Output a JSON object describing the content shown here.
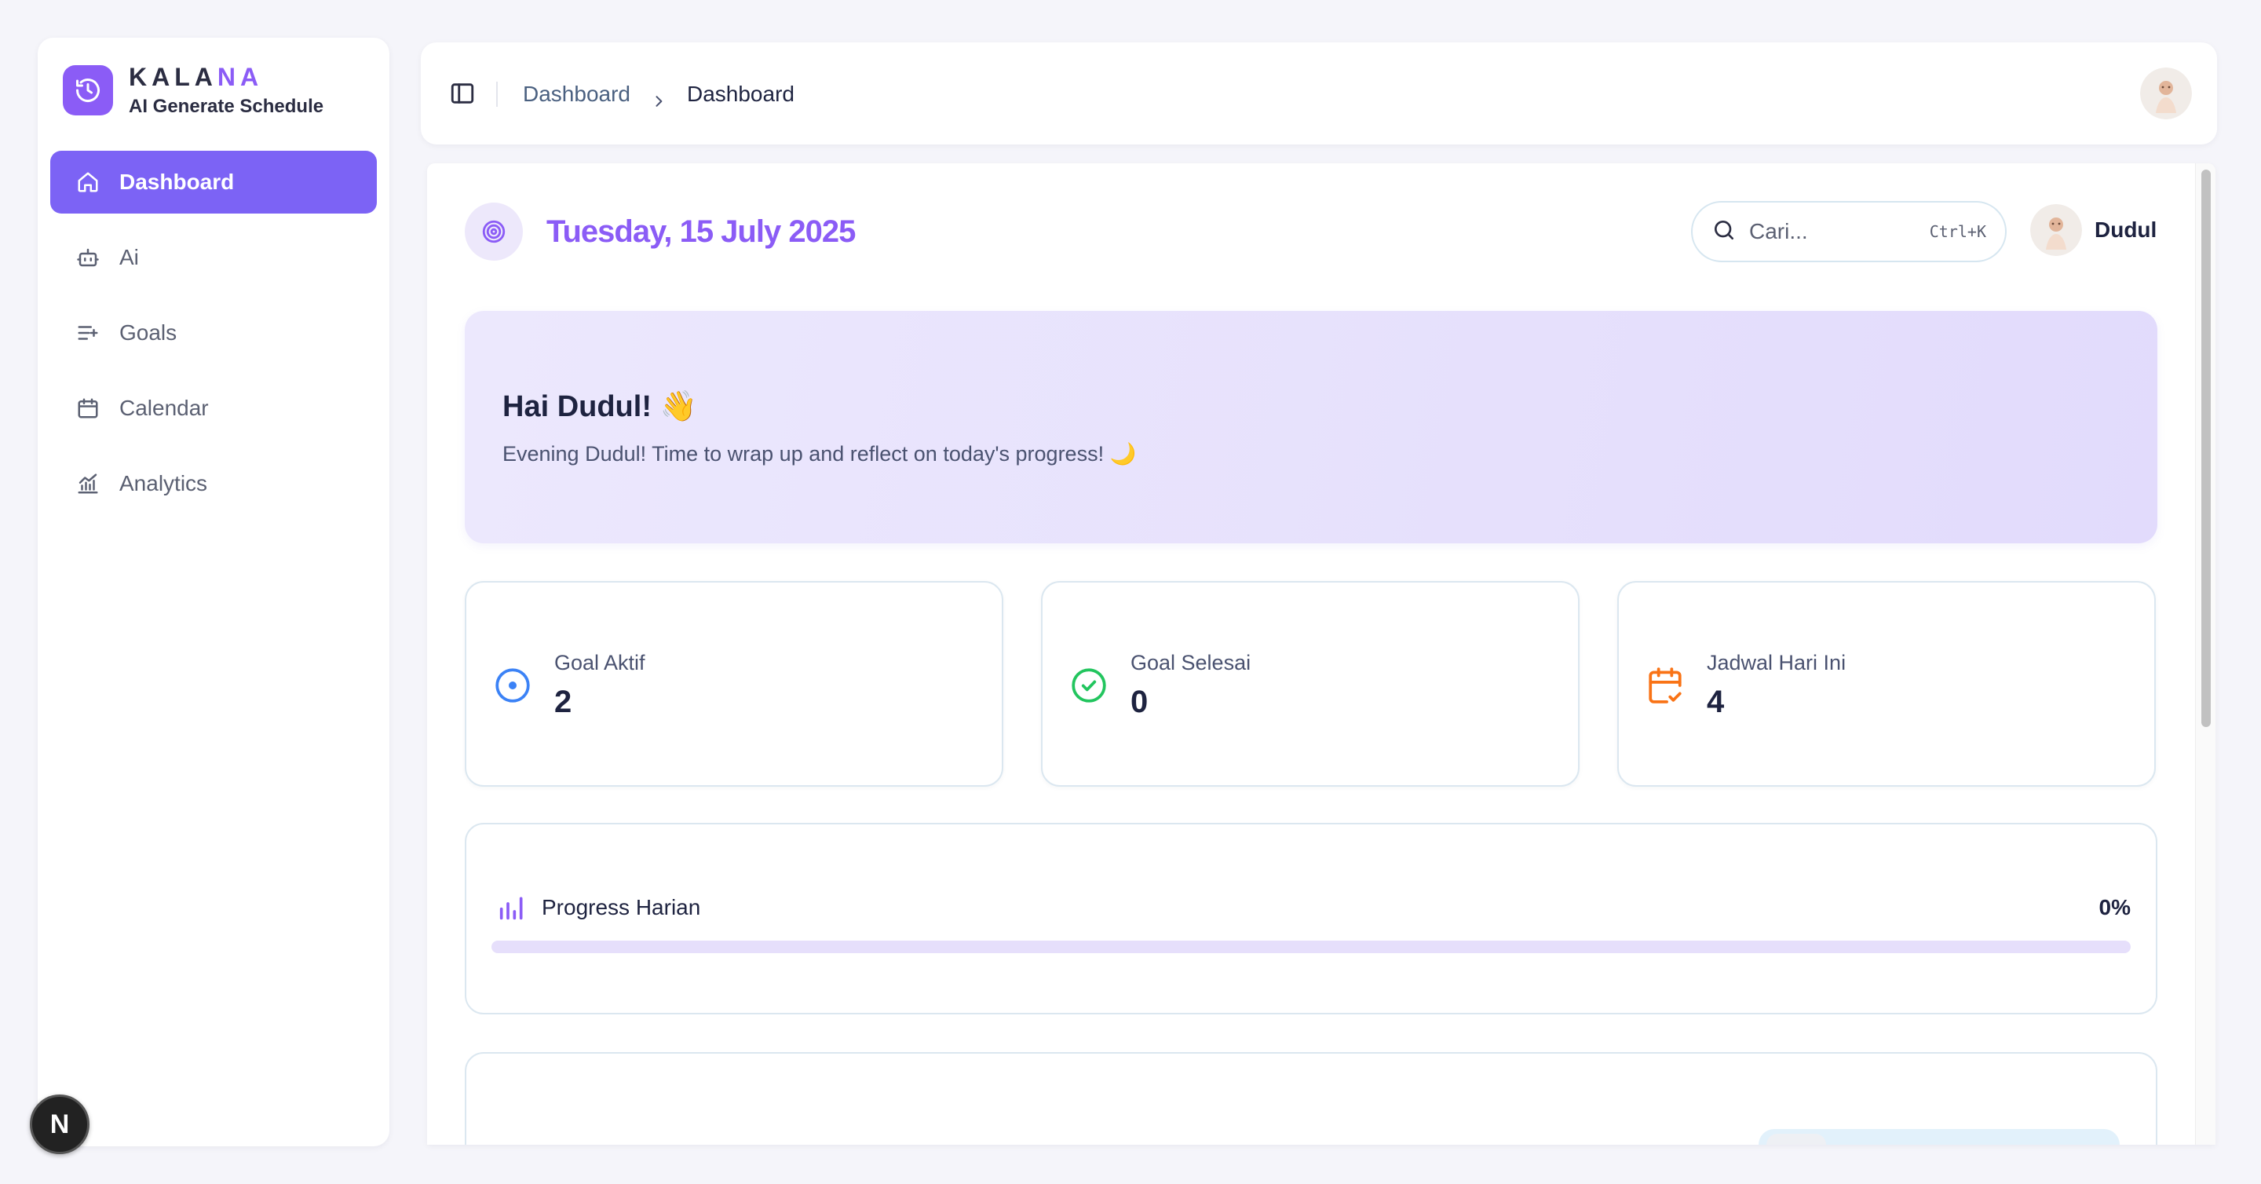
{
  "brand": {
    "name_main": "KALA",
    "name_accent": "NA",
    "subtitle": "AI Generate Schedule"
  },
  "sidebar": {
    "items": [
      {
        "label": "Dashboard",
        "icon": "home-icon",
        "active": true
      },
      {
        "label": "Ai",
        "icon": "bot-icon",
        "active": false
      },
      {
        "label": "Goals",
        "icon": "list-plus-icon",
        "active": false
      },
      {
        "label": "Calendar",
        "icon": "calendar-icon",
        "active": false
      },
      {
        "label": "Analytics",
        "icon": "chart-line-icon",
        "active": false
      }
    ]
  },
  "dev_badge": "N",
  "topbar": {
    "breadcrumb": [
      "Dashboard",
      "Dashboard"
    ]
  },
  "header": {
    "date": "Tuesday, 15 July 2025",
    "search_placeholder": "Cari...",
    "search_shortcut": "Ctrl+K",
    "user_name": "Dudul"
  },
  "hero": {
    "title": "Hai Dudul! 👋",
    "subtitle": "Evening Dudul! Time to wrap up and reflect on today's progress! 🌙"
  },
  "stats": [
    {
      "label": "Goal Aktif",
      "value": "2",
      "icon": "target-icon",
      "color": "#3b82f6"
    },
    {
      "label": "Goal Selesai",
      "value": "0",
      "icon": "check-circle-icon",
      "color": "#22c55e"
    },
    {
      "label": "Jadwal Hari Ini",
      "value": "4",
      "icon": "calendar-check-icon",
      "color": "#f97316"
    }
  ],
  "progress": {
    "title": "Progress Harian",
    "percent_label": "0%",
    "percent": 0
  },
  "colors": {
    "accent": "#8b5cf6",
    "nav_active": "#7c63f5",
    "background": "#f5f5fa"
  }
}
